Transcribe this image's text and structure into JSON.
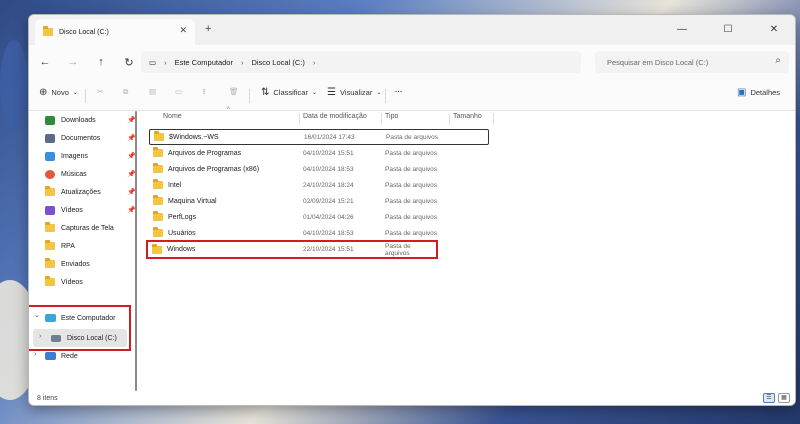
{
  "window": {
    "tab_title": "Disco Local (C:)",
    "new_tab": "+",
    "controls": {
      "minimize": "—",
      "maximize": "☐",
      "close": "✕"
    }
  },
  "nav": {
    "back": "←",
    "forward": "→",
    "up": "↑",
    "refresh": "↻"
  },
  "address": {
    "monitor_icon": "▭",
    "breadcrumb": [
      "Este Computador",
      "Disco Local (C:)"
    ],
    "separator": "›"
  },
  "search": {
    "placeholder": "Pesquisar em Disco Local (C:)",
    "icon": "search-icon"
  },
  "toolbar": {
    "new_label": "Novo",
    "sort_label": "Classificar",
    "view_label": "Visualizar",
    "more": "···",
    "details_label": "Detalhes"
  },
  "sidebar": {
    "quick_access": [
      {
        "label": "Downloads",
        "icon": "download-icon",
        "color": "#2f8a3a",
        "pinned": true
      },
      {
        "label": "Documentos",
        "icon": "documents-icon",
        "color": "#5a6b87",
        "pinned": true
      },
      {
        "label": "Imagens",
        "icon": "pictures-icon",
        "color": "#3b8ed9",
        "pinned": true
      },
      {
        "label": "Músicas",
        "icon": "music-icon",
        "color": "#e2583e",
        "pinned": true
      },
      {
        "label": "Atualizações",
        "icon": "folder-icon",
        "color": "#f4c542",
        "pinned": true
      },
      {
        "label": "Vídeos",
        "icon": "videos-icon",
        "color": "#7b4fd1",
        "pinned": true
      },
      {
        "label": "Capturas de Tela",
        "icon": "folder-icon",
        "color": "#f4c542",
        "pinned": false
      },
      {
        "label": "RPA",
        "icon": "folder-icon",
        "color": "#f4c542",
        "pinned": false
      },
      {
        "label": "Enviados",
        "icon": "folder-icon",
        "color": "#f4c542",
        "pinned": false
      },
      {
        "label": "Vídeos",
        "icon": "folder-icon",
        "color": "#f4c542",
        "pinned": false
      }
    ],
    "this_pc": "Este Computador",
    "local_disk": "Disco Local (C:)",
    "network": "Rede",
    "expanded": "⌄",
    "collapsed": "›"
  },
  "columns": [
    "Nome",
    "Data de modificação",
    "Tipo",
    "Tamanho"
  ],
  "files": [
    {
      "name": "$Windows.~WS",
      "date": "16/01/2024 17:43",
      "type": "Pasta de arquivos"
    },
    {
      "name": "Arquivos de Programas",
      "date": "04/10/2024 15:51",
      "type": "Pasta de arquivos"
    },
    {
      "name": "Arquivos de Programas (x86)",
      "date": "04/10/2024 18:53",
      "type": "Pasta de arquivos"
    },
    {
      "name": "Intel",
      "date": "24/10/2024 18:24",
      "type": "Pasta de arquivos"
    },
    {
      "name": "Maquina Virtual",
      "date": "02/09/2024 15:21",
      "type": "Pasta de arquivos"
    },
    {
      "name": "PerfLogs",
      "date": "01/04/2024 04:26",
      "type": "Pasta de arquivos"
    },
    {
      "name": "Usuários",
      "date": "04/10/2024 18:53",
      "type": "Pasta de arquivos"
    },
    {
      "name": "Windows",
      "date": "22/10/2024 15:51",
      "type": "Pasta de arquivos"
    }
  ],
  "status": {
    "item_count": "8 itens"
  },
  "colors": {
    "highlight": "#d11d1d",
    "folder": "#f4c542",
    "accent": "#0067c0"
  }
}
